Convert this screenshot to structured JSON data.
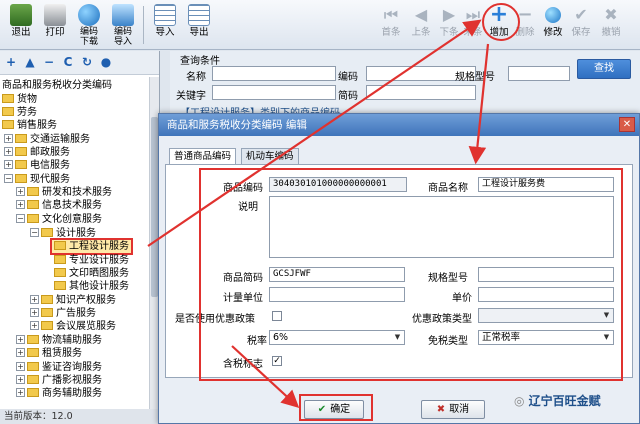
{
  "toolbar": {
    "left_buttons": [
      {
        "label": "退出",
        "icon": "exit-icon"
      },
      {
        "label": "打印",
        "icon": "printer-icon"
      },
      {
        "label": "编码\n下载",
        "icon": "download-globe-icon"
      },
      {
        "label": "编码\n导入",
        "icon": "import-icon"
      },
      {
        "label": "导入",
        "icon": "table-import-icon"
      },
      {
        "label": "导出",
        "icon": "table-export-icon"
      }
    ],
    "right_buttons": [
      {
        "label": "首条",
        "icon": "first-record-icon",
        "enabled": false
      },
      {
        "label": "上条",
        "icon": "prev-record-icon",
        "enabled": false
      },
      {
        "label": "下条",
        "icon": "next-record-icon",
        "enabled": false
      },
      {
        "label": "末条",
        "icon": "last-record-icon",
        "enabled": false
      },
      {
        "label": "增加",
        "icon": "add-icon",
        "enabled": true
      },
      {
        "label": "删除",
        "icon": "delete-icon",
        "enabled": false
      },
      {
        "label": "修改",
        "icon": "edit-icon",
        "enabled": true
      },
      {
        "label": "保存",
        "icon": "save-check-icon",
        "enabled": false
      },
      {
        "label": "撤销",
        "icon": "undo-icon",
        "enabled": false
      }
    ]
  },
  "tree": {
    "tools": [
      "+",
      "▲",
      "−",
      "C",
      "↻",
      "●"
    ],
    "header": "商品和服务税收分类编码",
    "nodes": [
      {
        "label": "货物"
      },
      {
        "label": "劳务"
      },
      {
        "label": "销售服务"
      },
      {
        "label": "交通运输服务"
      },
      {
        "label": "邮政服务"
      },
      {
        "label": "电信服务"
      },
      {
        "label": "现代服务"
      },
      {
        "label": "研发和技术服务"
      },
      {
        "label": "信息技术服务"
      },
      {
        "label": "文化创意服务"
      },
      {
        "label": "设计服务"
      },
      {
        "label": "工程设计服务"
      },
      {
        "label": "专业设计服务"
      },
      {
        "label": "文印晒图服务"
      },
      {
        "label": "其他设计服务"
      },
      {
        "label": "知识产权服务"
      },
      {
        "label": "广告服务"
      },
      {
        "label": "会议展览服务"
      },
      {
        "label": "物流辅助服务"
      },
      {
        "label": "租赁服务"
      },
      {
        "label": "鉴证咨询服务"
      },
      {
        "label": "广播影视服务"
      },
      {
        "label": "商务辅助服务"
      }
    ],
    "status": "当前版本：12.0"
  },
  "query": {
    "title": "查询条件",
    "name_label": "名称",
    "code_label": "编码",
    "spec_label": "规格型号",
    "keyword_label": "关键字",
    "short_code_label": "简码",
    "search_button": "查找",
    "hidden_strip": "【工程设计服务】类别下的商品编码"
  },
  "dialog": {
    "title": "商品和服务税收分类编码 编辑",
    "tabs": [
      "普通商品编码",
      "机动车编码"
    ],
    "fields": {
      "code_label": "商品编码",
      "code_value": "304030101000000000001",
      "name_label": "商品名称",
      "name_value": "工程设计服务费",
      "desc_label": "说明",
      "short_code_label": "商品简码",
      "short_code_value": "GCSJFWF",
      "spec_label": "规格型号",
      "unit_label": "计量单位",
      "price_label": "单价",
      "use_preference_label": "是否使用优惠政策",
      "preference_type_label": "优惠政策类型",
      "tax_rate_label": "税率",
      "tax_rate_value": "6%",
      "exempt_type_label": "免税类型",
      "exempt_type_value": "正常税率",
      "tax_included_label": "含税标志",
      "tax_included_mark": "✓"
    },
    "ok_button": "确定",
    "cancel_button": "取消"
  },
  "watermark": "辽宁百旺金赋",
  "colors": {
    "accent_red": "#e0322f",
    "title_blue": "#3f74ba"
  }
}
